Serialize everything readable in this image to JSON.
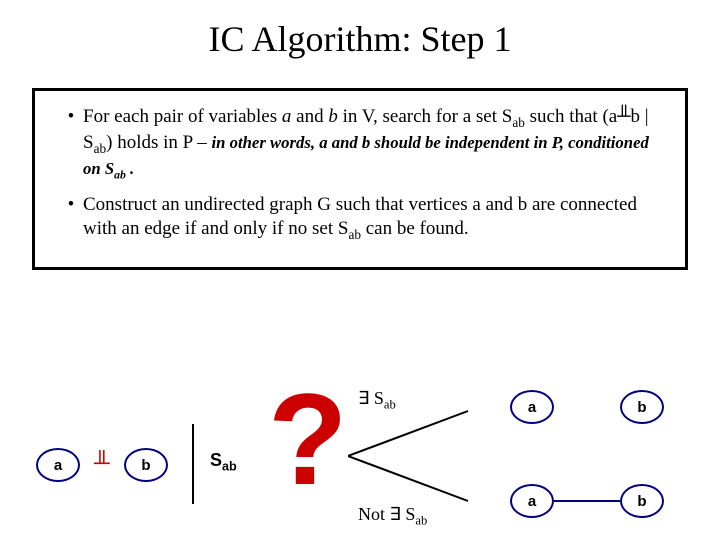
{
  "title": "IC Algorithm: Step 1",
  "bullets": [
    {
      "pre": "For each pair of variables ",
      "var_a": "a",
      "mid1": " and ",
      "var_b": "b",
      "mid2": " in V, search for a set S",
      "sab_sub": "ab",
      "mid3": " such that (a",
      "indep": "╨",
      "mid4": "b | S",
      "sab_sub2": "ab",
      "mid5": ") holds in P – ",
      "note": "in other words, a and b should be independent in P, conditioned on S",
      "note_sub": "ab",
      "note_end": " ."
    },
    {
      "text": "Construct an undirected graph G such that vertices a and b are connected with an edge if and only if no set S",
      "sub": "ab",
      "end": " can be found."
    }
  ],
  "diagram": {
    "node_a": "a",
    "node_b": "b",
    "indep_symbol": "╨",
    "sab": "S",
    "sab_sub": "ab",
    "qmark": "?",
    "exists_sab": "∃ S",
    "not_exists_sab": "Not ∃ S",
    "right_a1": "a",
    "right_b1": "b",
    "right_a2": "a",
    "right_b2": "b"
  }
}
